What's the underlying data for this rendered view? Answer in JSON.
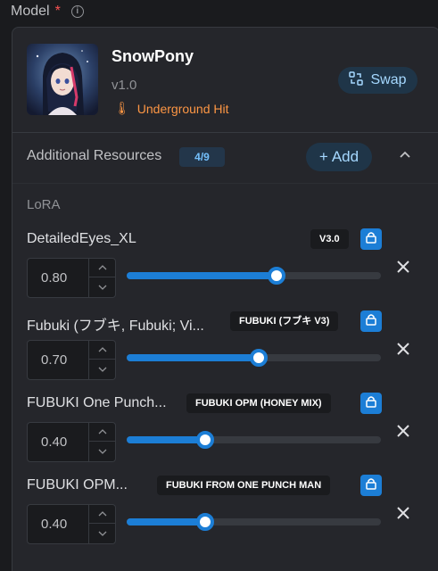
{
  "header": {
    "label": "Model",
    "required_mark": "*",
    "info_icon": "info-icon"
  },
  "model": {
    "name": "SnowPony",
    "version": "v1.0",
    "creator": "Underground Hit",
    "swap_label": "Swap"
  },
  "resources": {
    "title": "Additional Resources",
    "count": "4/9",
    "add_label": "Add",
    "section": "LoRA",
    "items": [
      {
        "name": "DetailedEyes_XL",
        "version": "V3.0",
        "value": "0.80",
        "strength": 0.8
      },
      {
        "name": "Fubuki (フブキ, Fubuki; Vi...",
        "version": "FUBUKI (フブキ V3)",
        "value": "0.70",
        "strength": 0.7
      },
      {
        "name": "FUBUKI One Punch...",
        "version": "FUBUKI OPM (HONEY MIX)",
        "value": "0.40",
        "strength": 0.4
      },
      {
        "name": "FUBUKI OPM...",
        "version": "FUBUKI FROM ONE PUNCH MAN",
        "value": "0.40",
        "strength": 0.4
      }
    ]
  },
  "colors": {
    "accent": "#1c7ed6",
    "creator": "#fd9644",
    "required": "#fa5252"
  }
}
